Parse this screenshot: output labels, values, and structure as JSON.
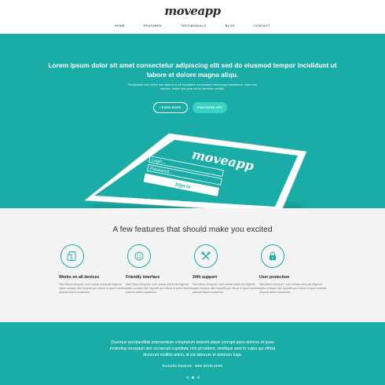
{
  "brand": {
    "logo": "moveapp"
  },
  "nav": {
    "items": [
      "HOME",
      "FEATURES",
      "TESTIMONIALS",
      "BLOG",
      "CONTACT"
    ]
  },
  "hero": {
    "headline": "Lorem ipsum dolor sit amet consectetur adipiscing elit sed do eiusmod tempor incididunt ut labore et dolore magna aliqu.",
    "subtext": "Perspiciatis unde omnis iste natus error sit voluptatem accusantium doloremque laudantium, totam rem aperiam, eaque ipsa quae ab illo inventore veritatis.",
    "learn_label": "LEARN MORE",
    "purchase_label": "PURCHASE APP",
    "device": {
      "logo": "moveapp",
      "login_placeholder": "Login...",
      "password_placeholder": "Password...",
      "signin_label": "Sign in"
    }
  },
  "features": {
    "heading": "A few features that should make you excited",
    "items": [
      {
        "icon": "devices-icon",
        "title": "Works on all devices",
        "text": "Nam libero tempore, cum soluta nobis est eligendi optio cumque nihil impedit quo minus id quod maxime placeat facere possimus."
      },
      {
        "icon": "smiley-icon",
        "title": "Friendly interface",
        "text": "Nam libero tempore, cum soluta nobis est eligendi optio cumque nihil impedit quo minus id quod maxime placeat facere possimus."
      },
      {
        "icon": "tools-icon",
        "title": "24/h support",
        "text": "Nam libero tempore, cum soluta nobis est eligendi optio cumque nihil impedit quo minus id quod maxime placeat facere possimus."
      },
      {
        "icon": "lock-icon",
        "title": "User protection",
        "text": "Nam libero tempore, cum soluta nobis est eligendi optio cumque nihil impedit quo minus id quod maxime placeat facere possimus."
      }
    ]
  },
  "testimonial": {
    "quote": "Ducimus qui blanditiis praesentium voluptatum deleniti atque corrupti quos dolores et quas molestias excepturi sint occaecati cupiditate non provident, similique sunt in culpa qui officia deserunt mollitia animi, id est laborum et dolorum fuga.",
    "author": "RICHARD RANSOM - WEB DEVELOPER",
    "slides": 3,
    "active_slide": 2
  },
  "colors": {
    "teal": "#1aaca6",
    "accent": "#38d2c3",
    "light_bg": "#f3f3f3"
  }
}
